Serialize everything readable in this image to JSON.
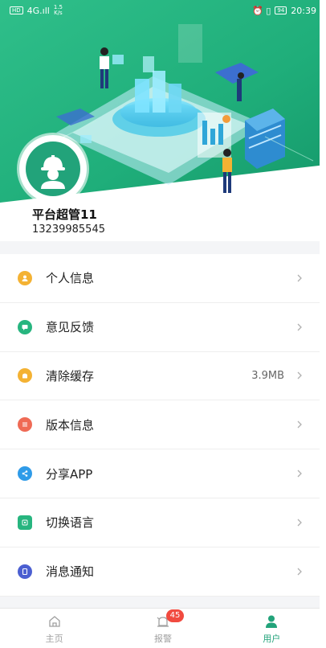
{
  "status_bar": {
    "left_badge": "HD",
    "signal": "4G.ıll",
    "speed_value": "1.5",
    "speed_unit": "K/s",
    "right_icons": "⏰ ▯ ",
    "battery": "94",
    "time": "20:39"
  },
  "profile": {
    "name": "平台超管11",
    "phone": "13239985545"
  },
  "menu": [
    {
      "label": "个人信息",
      "value": "",
      "icon": "user-icon",
      "color": "#f4b233"
    },
    {
      "label": "意见反馈",
      "value": "",
      "icon": "feedback-icon",
      "color": "#27b57f"
    },
    {
      "label": "清除缓存",
      "value": "3.9MB",
      "icon": "cache-icon",
      "color": "#f4b233"
    },
    {
      "label": "版本信息",
      "value": "",
      "icon": "version-icon",
      "color": "#ef6a55"
    },
    {
      "label": "分享APP",
      "value": "",
      "icon": "share-icon",
      "color": "#2f9be8"
    },
    {
      "label": "切换语言",
      "value": "",
      "icon": "language-icon",
      "color": "#27b57f"
    },
    {
      "label": "消息通知",
      "value": "",
      "icon": "notification-icon",
      "color": "#4b5fd1"
    }
  ],
  "tabbar": {
    "home": "主页",
    "alarm": "报警",
    "alarm_badge": "45",
    "user": "用户",
    "active_color": "#22a37a"
  }
}
